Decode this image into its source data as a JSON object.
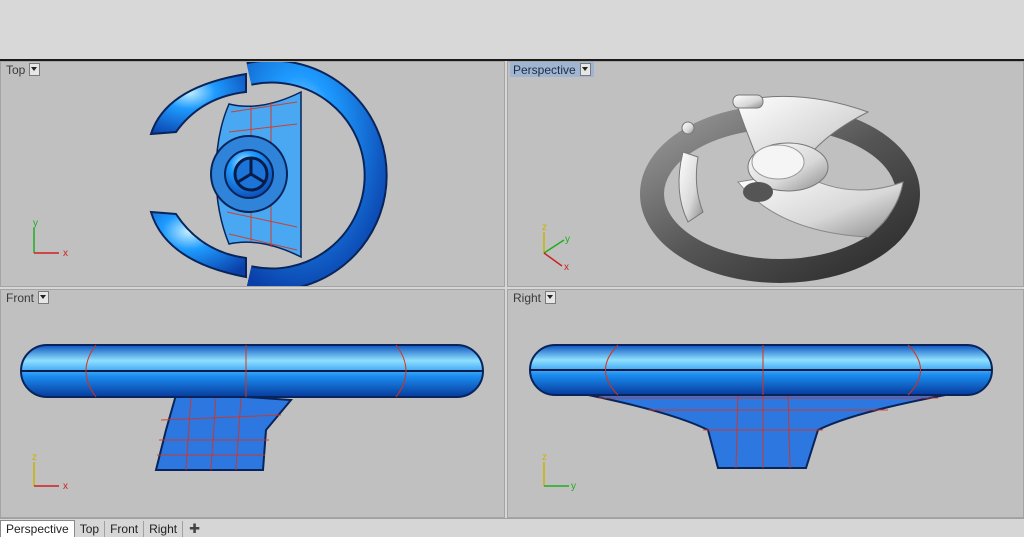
{
  "viewports": {
    "top": {
      "title": "Top",
      "axis_x": "x",
      "axis_y": "y"
    },
    "perspective": {
      "title": "Perspective",
      "axis_x": "x",
      "axis_y": "y",
      "axis_z": "z"
    },
    "front": {
      "title": "Front",
      "axis_x": "x",
      "axis_z": "z"
    },
    "right": {
      "title": "Right",
      "axis_y": "y",
      "axis_z": "z"
    }
  },
  "tabs": [
    {
      "label": "Perspective",
      "active": true
    },
    {
      "label": "Top"
    },
    {
      "label": "Front"
    },
    {
      "label": "Right"
    }
  ],
  "tab_add_icon": "plus-icon",
  "colors": {
    "viewport_bg": "#c0c0c0",
    "model_blue": "#1a8cf0",
    "wire_red": "#e03010",
    "active_title": "#9fb5d1"
  }
}
